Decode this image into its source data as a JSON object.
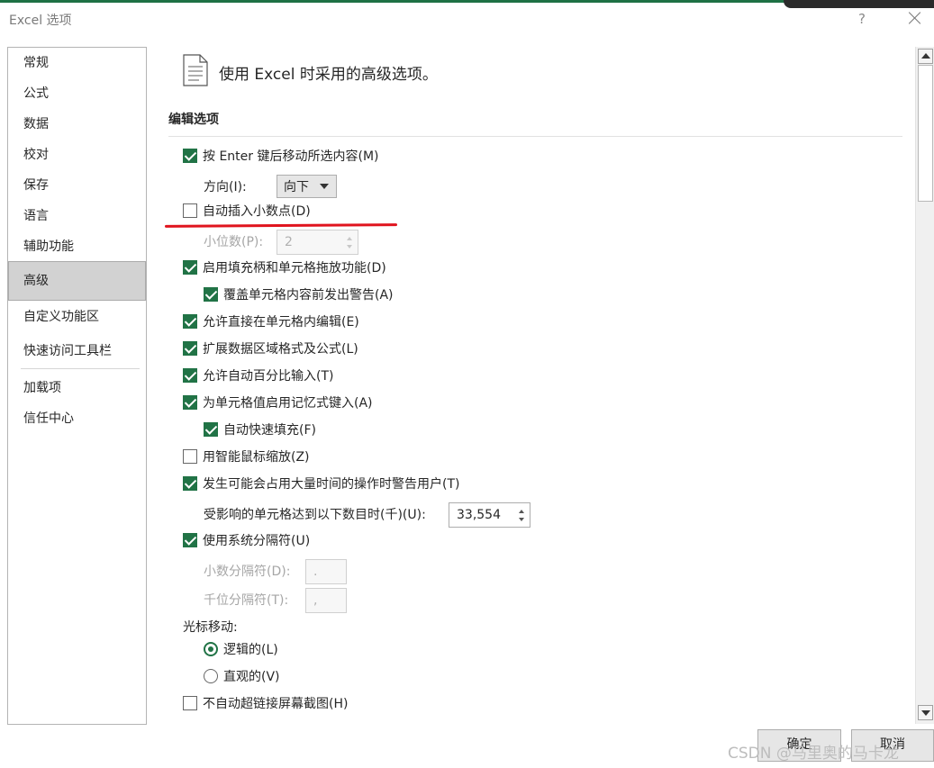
{
  "window": {
    "title": "Excel 选项",
    "help": "?"
  },
  "sidebar": {
    "items": [
      "常规",
      "公式",
      "数据",
      "校对",
      "保存",
      "语言",
      "辅助功能",
      "高级",
      "自定义功能区",
      "快速访问工具栏",
      "加载项",
      "信任中心"
    ],
    "active": "高级"
  },
  "header": {
    "title": "使用 Excel 时采用的高级选项。"
  },
  "section": {
    "title": "编辑选项"
  },
  "options": {
    "move_after_enter": {
      "label": "按 Enter 键后移动所选内容(M)",
      "checked": true
    },
    "direction": {
      "label": "方向(I):",
      "value": "向下"
    },
    "auto_decimal": {
      "label": "自动插入小数点(D)",
      "checked": false
    },
    "decimal_places": {
      "label": "小位数(P):",
      "value": "2"
    },
    "fill_handle": {
      "label": "启用填充柄和单元格拖放功能(D)",
      "checked": true
    },
    "overwrite_warn": {
      "label": "覆盖单元格内容前发出警告(A)",
      "checked": true
    },
    "edit_in_cell": {
      "label": "允许直接在单元格内编辑(E)",
      "checked": true
    },
    "extend_formats": {
      "label": "扩展数据区域格式及公式(L)",
      "checked": true
    },
    "auto_percent": {
      "label": "允许自动百分比输入(T)",
      "checked": true
    },
    "autocomplete": {
      "label": "为单元格值启用记忆式键入(A)",
      "checked": true
    },
    "flash_fill": {
      "label": "自动快速填充(F)",
      "checked": true
    },
    "intellimouse": {
      "label": "用智能鼠标缩放(Z)",
      "checked": false
    },
    "alert_slow": {
      "label": "发生可能会占用大量时间的操作时警告用户(T)",
      "checked": true
    },
    "cells_threshold": {
      "label": "受影响的单元格达到以下数目时(千)(U):",
      "value": "33,554"
    },
    "system_separators": {
      "label": "使用系统分隔符(U)",
      "checked": true
    },
    "decimal_separator": {
      "label": "小数分隔符(D):",
      "value": "."
    },
    "thousands_separator": {
      "label": "千位分隔符(T):",
      "value": ","
    },
    "cursor_movement": {
      "label": "光标移动:"
    },
    "logical": {
      "label": "逻辑的(L)",
      "checked": true
    },
    "visual": {
      "label": "直观的(V)",
      "checked": false
    },
    "no_hyperlink_screenshot": {
      "label": "不自动超链接屏幕截图(H)",
      "checked": false
    }
  },
  "buttons": {
    "ok": "确定",
    "cancel": "取消"
  },
  "watermark": "CSDN @马里奥的马卡龙",
  "colors": {
    "accent": "#217346",
    "annotation": "#e0141e"
  },
  "icons": [
    "document-icon",
    "close-icon",
    "scroll-up-icon",
    "scroll-down-icon",
    "dropdown-arrow-icon",
    "spin-up-icon",
    "spin-down-icon"
  ]
}
